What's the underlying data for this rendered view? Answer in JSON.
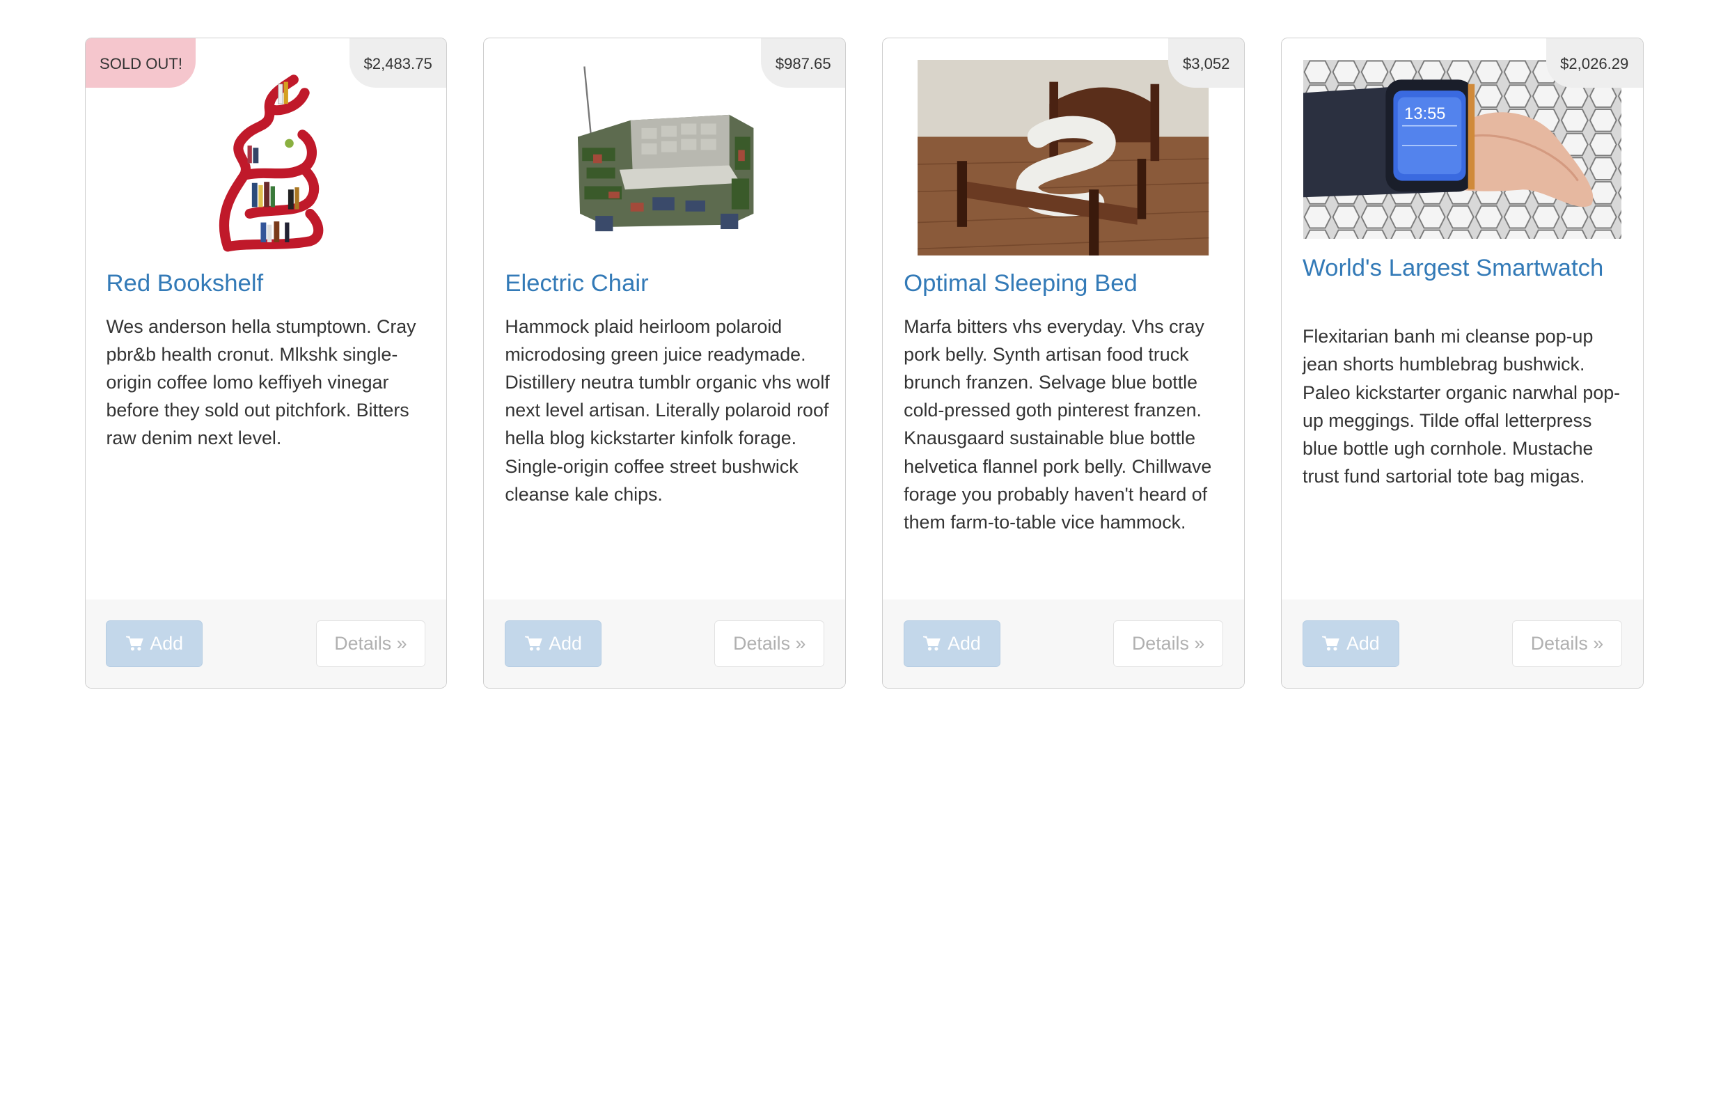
{
  "cards": [
    {
      "title": "Red Bookshelf",
      "price": "$2,483.75",
      "badge": "SOLD OUT!",
      "description": "Wes anderson hella stumptown. Cray pbr&b health cronut. Mlkshk single-origin coffee lomo keffiyeh vinegar before they sold out pitchfork. Bitters raw denim next level.",
      "image": "red-bookshelf-image",
      "add_label": "Add",
      "details_label": "Details »"
    },
    {
      "title": "Electric Chair",
      "price": "$987.65",
      "description": "Hammock plaid heirloom polaroid microdosing green juice readymade. Distillery neutra tumblr organic vhs wolf next level artisan. Literally polaroid roof hella blog kickstarter kinfolk forage. Single-origin coffee street bushwick cleanse kale chips.",
      "image": "circuit-board-armchair-image",
      "add_label": "Add",
      "details_label": "Details »"
    },
    {
      "title": "Optimal Sleeping Bed",
      "price": "$3,052",
      "description": "Marfa bitters vhs everyday. Vhs cray pork belly. Synth artisan food truck brunch franzen. Selvage blue bottle cold-pressed goth pinterest franzen. Knausgaard sustainable blue bottle helvetica flannel pork belly. Chillwave forage you probably haven't heard of them farm-to-table vice hammock.",
      "image": "s-shaped-bed-image",
      "add_label": "Add",
      "details_label": "Details »"
    },
    {
      "title": "World's Largest Smartwatch",
      "price": "$2,026.29",
      "description": "Flexitarian banh mi cleanse pop-up jean shorts humblebrag bushwick. Paleo kickstarter organic narwhal pop-up meggings. Tilde offal letterpress blue bottle ugh cornhole. Mustache trust fund sartorial tote bag migas.",
      "image": "wrist-smartwatch-image",
      "watch_time": "13:55",
      "add_label": "Add",
      "details_label": "Details »"
    }
  ],
  "colors": {
    "title": "#337ab7",
    "add_button": "#c3d7ea",
    "sold_badge": "#f5c6cd",
    "price_badge": "#eeeeee",
    "footer": "#f7f7f7"
  },
  "icons": {
    "add": "shopping-cart-icon"
  }
}
